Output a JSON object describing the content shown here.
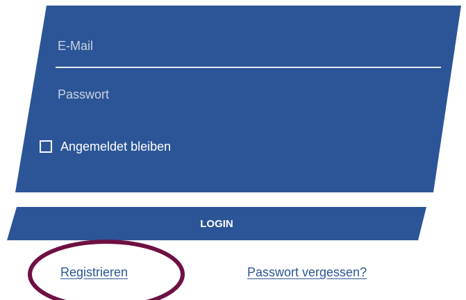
{
  "login_form": {
    "email_placeholder": "E-Mail",
    "email_value": "",
    "password_placeholder": "Passwort",
    "password_value": "",
    "remember_label": "Angemeldet bleiben",
    "remember_checked": false,
    "login_label": "LOGIN"
  },
  "links": {
    "register": "Registrieren",
    "forgot_password": "Passwort vergessen?"
  },
  "colors": {
    "panel": "#2c5597",
    "link": "#2c5597",
    "annotation_ellipse": "#6e1042"
  }
}
